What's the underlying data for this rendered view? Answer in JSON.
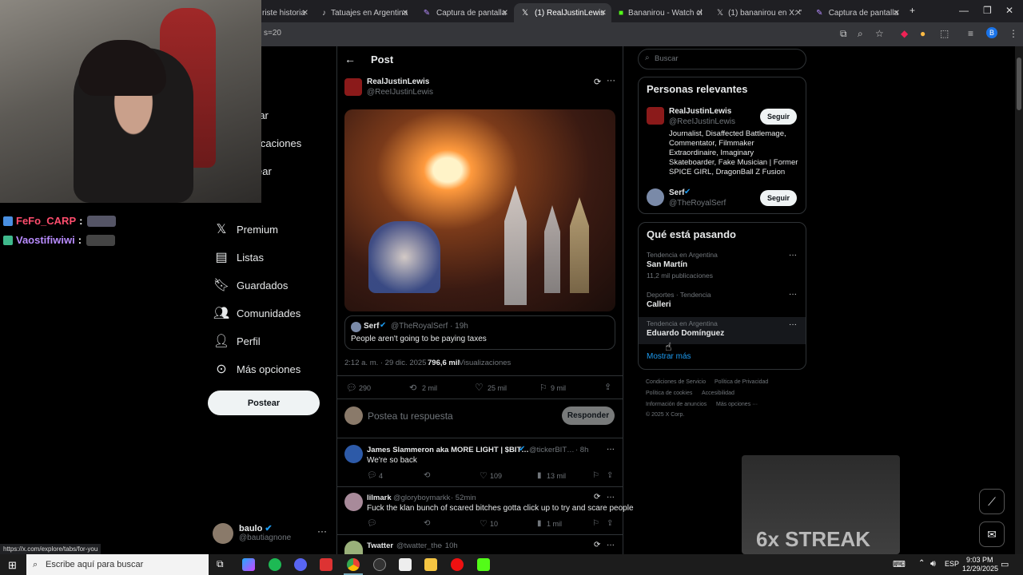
{
  "tabs": [
    {
      "label": "riste historia"
    },
    {
      "label": "Tatuajes en Argentina"
    },
    {
      "label": "Captura de pantalla"
    },
    {
      "label": "(1) RealJustinLewis"
    },
    {
      "label": "Bananirou - Watch cl"
    },
    {
      "label": "(1) bananirou en X: \""
    },
    {
      "label": "Captura de pantalla"
    }
  ],
  "url": "s=20",
  "chat": [
    {
      "user": "FeFo_CARP",
      "sep": ":"
    },
    {
      "user": "Vaostifiwiwi",
      "sep": ":"
    }
  ],
  "nav": {
    "partial1": "rar",
    "partial2": "icaciones",
    "partial3": "ear",
    "premium": "Premium",
    "listas": "Listas",
    "guardados": "Guardados",
    "comunidades": "Comunidades",
    "perfil": "Perfil",
    "mas": "Más opciones",
    "postear": "Postear",
    "user_name": "baulo",
    "user_handle": "@bautiagnone"
  },
  "post": {
    "header": "Post",
    "author": "RealJustinLewis",
    "handle": "@ReeIJustinLewis",
    "quote_name": "Serf",
    "quote_handle": "@TheRoyalSerf · 19h",
    "quote_text": "People aren't going to be paying taxes",
    "time": "2:12 a. m. · 29 dic. 2025 ·",
    "views_count": "796,6 mil",
    "views_label": "Visualizaciones",
    "replies": "290",
    "reposts": "2 mil",
    "likes": "25 mil",
    "bookmarks": "9 mil",
    "reply_placeholder": "Postea tu respuesta",
    "reply_button": "Responder"
  },
  "replies": [
    {
      "name": "James Slammeron aka MORE LIGHT | $BIT…",
      "handle": "@tickerBIT…",
      "time": "· 8h",
      "text": "We're so back",
      "c1": "4",
      "c3": "109",
      "c4": "13 mil"
    },
    {
      "name": "lilmark",
      "handle": "@gloryboymarkk",
      "time": "· 52min",
      "text": "Fuck the klan bunch of scared bitches gotta click up to try and scare people",
      "c1": "",
      "c3": "10",
      "c4": "1 mil"
    },
    {
      "name": "Twatter",
      "handle": "@twatter_the",
      "time": "· 10h",
      "text": ""
    }
  ],
  "right": {
    "search_placeholder": "Buscar",
    "relevant_title": "Personas relevantes",
    "p1_name": "RealJustinLewis",
    "p1_handle": "@ReeIJustinLewis",
    "p1_bio": "Journalist, Disaffected Battlemage, Commentator, Filmmaker Extraordinaire, Imaginary Skateboarder, Fake Musician | Former SPICE GIRL, DragonBall Z Fusion",
    "p2_name": "Serf",
    "p2_handle": "@TheRoyalSerf",
    "follow": "Seguir",
    "trends_title": "Qué está pasando",
    "t1_ctx": "Tendencia en Argentina",
    "t1_name": "San Martín",
    "t1_count": "11,2 mil publicaciones",
    "t2_ctx": "Deportes · Tendencia",
    "t2_name": "Calleri",
    "t3_ctx": "Tendencia en Argentina",
    "t3_name": "Eduardo Domínguez",
    "show_more": "Mostrar más",
    "footer1": "Condiciones de Servicio",
    "footer2": "Política de Privacidad",
    "footer3": "Política de cookies",
    "footer4": "Accesibilidad",
    "footer5": "Información de anuncios",
    "footer6": "Más opciones ···",
    "footer7": "© 2025 X Corp."
  },
  "status_url": "https://x.com/explore/tabs/for-you",
  "overlay_text": "6x STREAK",
  "taskbar": {
    "search": "Escribe aquí para buscar",
    "lang": "ESP",
    "time": "9:03 PM",
    "date": "12/29/2025"
  }
}
